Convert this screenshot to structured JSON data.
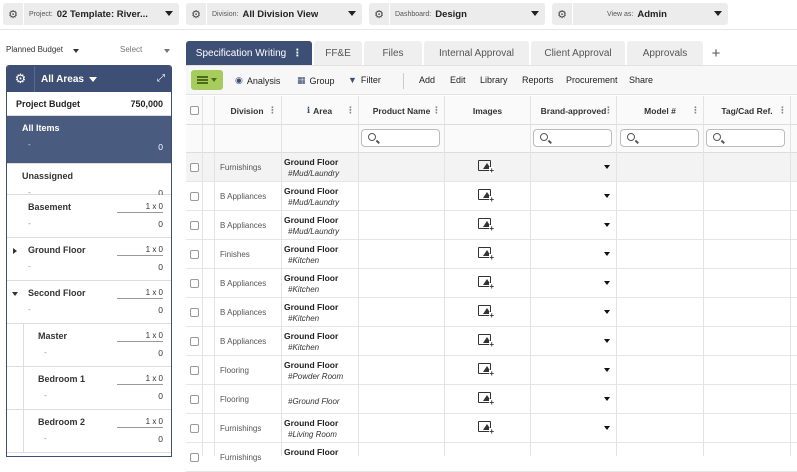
{
  "topbar": {
    "project": {
      "label": "Project:",
      "value": "02 Template: River..."
    },
    "division": {
      "label": "Division:",
      "value": "All Division View"
    },
    "dashboard": {
      "label": "Dashboard:",
      "value": "Design"
    },
    "view_as": {
      "label": "View as:",
      "value": "Admin"
    }
  },
  "left": {
    "planned_budget_label": "Planned Budget",
    "select_label": "Select",
    "panel_title": "All Areas",
    "project_budget": {
      "label": "Project Budget",
      "value": "750,000"
    },
    "areas": [
      {
        "name": "All Items",
        "dash": "-",
        "total": "0",
        "qty": "",
        "selected": true,
        "toggle": "none",
        "indent": false
      },
      {
        "name": "Unassigned",
        "dash": "-",
        "total": "0",
        "qty": "",
        "selected": false,
        "toggle": "none",
        "indent": false
      },
      {
        "name": "Basement",
        "dash": "-",
        "total": "0",
        "qty": "1 x 0",
        "selected": false,
        "toggle": "none",
        "indent": false
      },
      {
        "name": "Ground Floor",
        "dash": "-",
        "total": "0",
        "qty": "1 x 0",
        "selected": false,
        "toggle": "collapsed",
        "indent": false
      },
      {
        "name": "Second Floor",
        "dash": "-",
        "total": "0",
        "qty": "1 x 0",
        "selected": false,
        "toggle": "expanded",
        "indent": false
      },
      {
        "name": "Master",
        "dash": "-",
        "total": "0",
        "qty": "1 x 0",
        "selected": false,
        "toggle": "none",
        "indent": true
      },
      {
        "name": "Bedroom 1",
        "dash": "-",
        "total": "0",
        "qty": "1 x 0",
        "selected": false,
        "toggle": "none",
        "indent": true
      },
      {
        "name": "Bedroom 2",
        "dash": "-",
        "total": "0",
        "qty": "1 x 0",
        "selected": false,
        "toggle": "none",
        "indent": true
      }
    ]
  },
  "tabs": [
    {
      "label": "Specification Writing",
      "active": true,
      "menu": "⋮"
    },
    {
      "label": "FF&E",
      "active": false,
      "menu": ""
    },
    {
      "label": "Files",
      "active": false,
      "menu": ""
    },
    {
      "label": "Internal Approval",
      "active": false,
      "menu": ""
    },
    {
      "label": "Client Approval",
      "active": false,
      "menu": ""
    },
    {
      "label": "Approvals",
      "active": false,
      "menu": ""
    }
  ],
  "tab_add": "+",
  "toolbar": {
    "analysis": "Analysis",
    "group": "Group",
    "filter": "Filter",
    "add": "Add",
    "edit": "Edit",
    "library": "Library",
    "reports": "Reports",
    "procurement": "Procurement",
    "share": "Share"
  },
  "table": {
    "columns": {
      "division": "Division",
      "area": "Area",
      "product_name": "Product Name",
      "images": "Images",
      "brand_approved": "Brand-approved",
      "model": "Model #",
      "tag": "Tag/Cad Ref."
    },
    "rows": [
      {
        "division": "Furnishings",
        "area": "Ground Floor",
        "sub": "#Mud/Laundry"
      },
      {
        "division": "B Appliances",
        "area": "Ground Floor",
        "sub": "#Mud/Laundry"
      },
      {
        "division": "B Appliances",
        "area": "Ground Floor",
        "sub": "#Mud/Laundry"
      },
      {
        "division": "Finishes",
        "area": "Ground Floor",
        "sub": "#Kitchen"
      },
      {
        "division": "B Appliances",
        "area": "Ground Floor",
        "sub": "#Kitchen"
      },
      {
        "division": "B Appliances",
        "area": "Ground Floor",
        "sub": "#Kitchen"
      },
      {
        "division": "B Appliances",
        "area": "Ground Floor",
        "sub": "#Kitchen"
      },
      {
        "division": "Flooring",
        "area": "Ground Floor",
        "sub": "#Powder Room"
      },
      {
        "division": "Flooring",
        "area": "",
        "sub": "#Ground Floor"
      },
      {
        "division": "Furnishings",
        "area": "Ground Floor",
        "sub": "#Living Room"
      },
      {
        "division": "Furnishings",
        "area": "Ground Floor",
        "sub": ""
      }
    ]
  },
  "colors": {
    "accent": "#3d4f74",
    "selected_area": "#4a5b80",
    "menu_green": "#a6cc5e"
  }
}
